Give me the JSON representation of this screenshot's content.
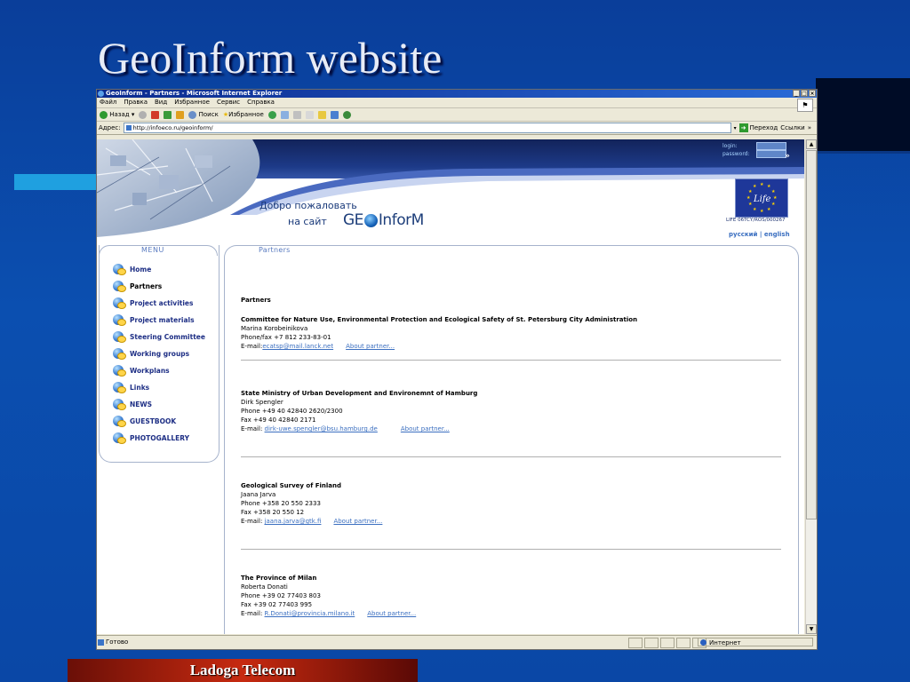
{
  "slide": {
    "title": "GeoInform website",
    "footer": "Ladoga Telecom"
  },
  "browser": {
    "window_title": "GeoInform - Partners - Microsoft Internet Explorer",
    "menu": [
      "Файл",
      "Правка",
      "Вид",
      "Избранное",
      "Сервис",
      "Справка"
    ],
    "toolbar": {
      "back": "Назад",
      "search": "Поиск",
      "favorites": "Избранное"
    },
    "address_label": "Адрес:",
    "url": "http://infoeco.ru/geoinform/",
    "go_label": "Переход",
    "links_label": "Ссылки",
    "status_text": "Готово",
    "zone_text": "Интернет"
  },
  "site": {
    "login_label": "login:",
    "password_label": "password:",
    "login_go": "»",
    "welcome_line1": "Добро пожаловать",
    "welcome_line2": "на сайт",
    "logo_left": "GE",
    "logo_right": "InforM",
    "life_code": "LIFE 06TCY/ROS/000267",
    "lang_ru": "русский",
    "lang_sep": "|",
    "lang_en": "english",
    "menu_title": "MENU",
    "menu_items": [
      {
        "label": "Home"
      },
      {
        "label": "Partners"
      },
      {
        "label": "Project activities"
      },
      {
        "label": "Project materials"
      },
      {
        "label": "Steering Committee"
      },
      {
        "label": "Working groups"
      },
      {
        "label": "Workplans"
      },
      {
        "label": "Links"
      },
      {
        "label": "NEWS"
      },
      {
        "label": "GUESTBOOK"
      },
      {
        "label": "PHOTOGALLERY"
      }
    ],
    "content_title": "Partners",
    "section_heading": "Partners",
    "about_label": "About partner...",
    "partners": [
      {
        "name": "Committee for Nature Use, Environmental Protection and Ecological Safety of St. Petersburg City Administration",
        "lines": [
          "Marina Korobeinikova",
          "Phone/fax +7 812 233-83-01"
        ],
        "email_label": "E-mail:",
        "email": "ecatsp@mail.lanck.net"
      },
      {
        "name": "State Ministry of Urban Development and Environemnt of Hamburg",
        "lines": [
          "Dirk Spengler",
          "Phone +49 40 42840 2620/2300",
          "Fax +49 40 42840 2171"
        ],
        "email_label": "E-mail:",
        "email": "dirk-uwe.spengler@bsu.hamburg.de"
      },
      {
        "name": "Geological Survey of Finland",
        "lines": [
          "Jaana Jarva",
          "Phone +358 20 550 2333",
          "Fax +358 20 550 12"
        ],
        "email_label": "E-mail:",
        "email": "jaana.jarva@gtk.fi"
      },
      {
        "name": "The Province of Milan",
        "lines": [
          "Roberta Donati",
          "Phone +39 02 77403 803",
          "Fax +39 02 77403 995"
        ],
        "email_label": "E-mail:",
        "email": "R.Donati@provincia.milano.it"
      }
    ]
  }
}
